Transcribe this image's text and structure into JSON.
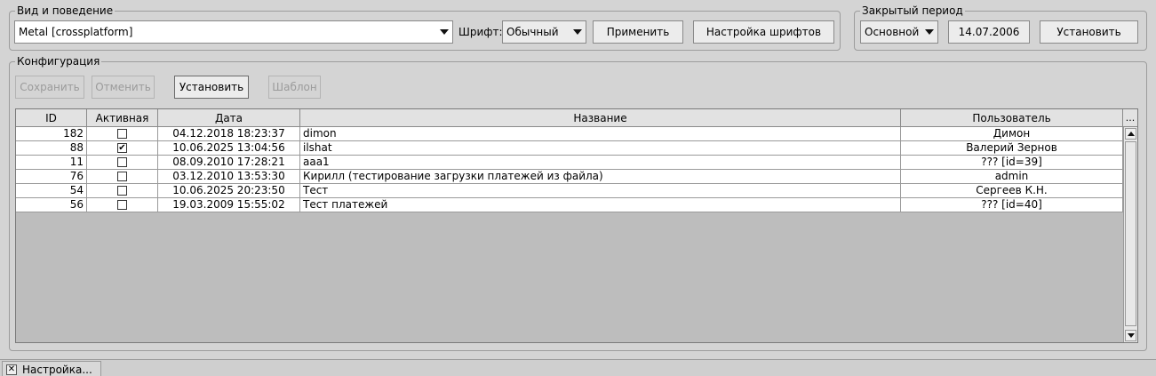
{
  "appearance": {
    "legend": "Вид и поведение",
    "laf_value": "Metal [crossplatform]",
    "font_label": "Шрифт:",
    "font_value": "Обычный",
    "apply_label": "Применить",
    "font_settings_label": "Настройка шрифтов"
  },
  "closed_period": {
    "legend": "Закрытый период",
    "mode_value": "Основной",
    "date_value": "14.07.2006",
    "set_label": "Установить"
  },
  "config": {
    "legend": "Конфигурация",
    "save_label": "Сохранить",
    "cancel_label": "Отменить",
    "set_label": "Установить",
    "template_label": "Шаблон"
  },
  "table": {
    "columns": [
      "ID",
      "Активная",
      "Дата",
      "Название",
      "Пользователь"
    ],
    "corner_label": "...",
    "rows": [
      {
        "id": "182",
        "active": false,
        "date": "04.12.2018 18:23:37",
        "name": "dimon",
        "user": "Димон"
      },
      {
        "id": "88",
        "active": true,
        "date": "10.06.2025 13:04:56",
        "name": "ilshat",
        "user": "Валерий Зернов"
      },
      {
        "id": "11",
        "active": false,
        "date": "08.09.2010 17:28:21",
        "name": "aaa1",
        "user": "??? [id=39]"
      },
      {
        "id": "76",
        "active": false,
        "date": "03.12.2010 13:53:30",
        "name": "Кирилл (тестирование загрузки платежей из файла)",
        "user": "admin"
      },
      {
        "id": "54",
        "active": false,
        "date": "10.06.2025 20:23:50",
        "name": "Тест",
        "user": "Сергеев К.Н."
      },
      {
        "id": "56",
        "active": false,
        "date": "19.03.2009 15:55:02",
        "name": "Тест платежей",
        "user": "??? [id=40]"
      }
    ]
  },
  "tabs": [
    {
      "label": "Настройка..."
    }
  ],
  "icons": {
    "checkbox_checked": "checkmark-icon",
    "tab_close": "close-icon"
  }
}
